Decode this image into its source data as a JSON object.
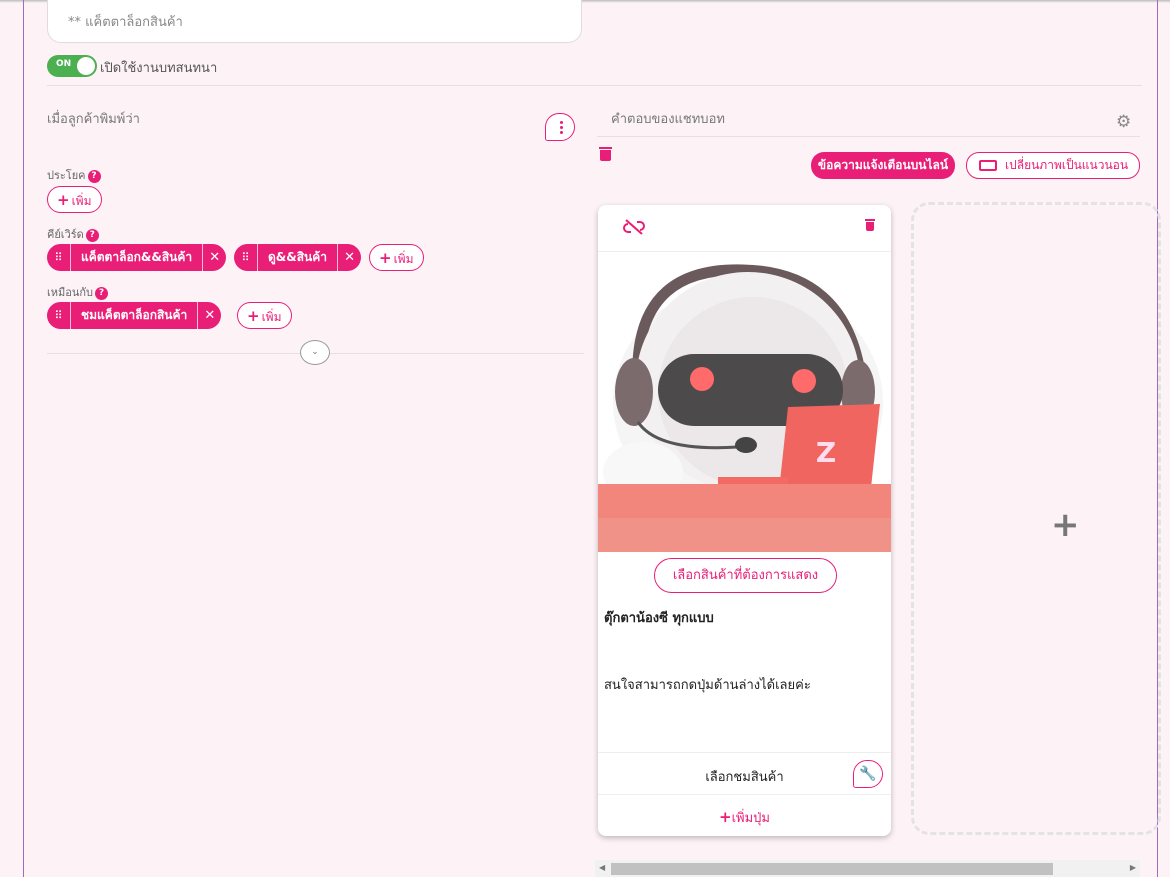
{
  "name_input": {
    "placeholder": "** แค็ตตาล็อกสินค้า"
  },
  "toggle": {
    "state": "ON",
    "label": "เปิดใช้งานบทสนทนา"
  },
  "left": {
    "title": "เมื่อลูกค้าพิมพ์ว่า",
    "sentence": {
      "label": "ประโยค",
      "add": "เพิ่ม"
    },
    "keyword": {
      "label": "คีย์เวิร์ด",
      "chips": [
        "แค็ตตาล็อก&&สินค้า",
        "ดู&&สินค้า"
      ],
      "add": "เพิ่ม"
    },
    "similar": {
      "label": "เหมือนกับ",
      "chips": [
        "ชมแค็ตตาล็อกสินค้า"
      ],
      "add": "เพิ่ม"
    }
  },
  "right": {
    "title": "คำตอบของแชทบอท",
    "notify_button": "ข้อความแจ้งเตือนบนไลน์",
    "landscape_button": "เปลี่ยนภาพเป็นแนวนอน"
  },
  "card": {
    "select_product_button": "เลือกสินค้าที่ต้องการแสดง",
    "title": "ตุ๊กตาน้องซี ทุกแบบ",
    "description": "สนใจสามารถกดปุ่มด้านล่างได้เลยค่ะ",
    "action_button": "เลือกชมสินค้า",
    "add_button": "เพิ่มปุ่ม",
    "laptop_logo": "Z"
  },
  "colors": {
    "accent": "#e91e77",
    "toggle_on": "#4caf50",
    "background": "#fdf3f7"
  }
}
